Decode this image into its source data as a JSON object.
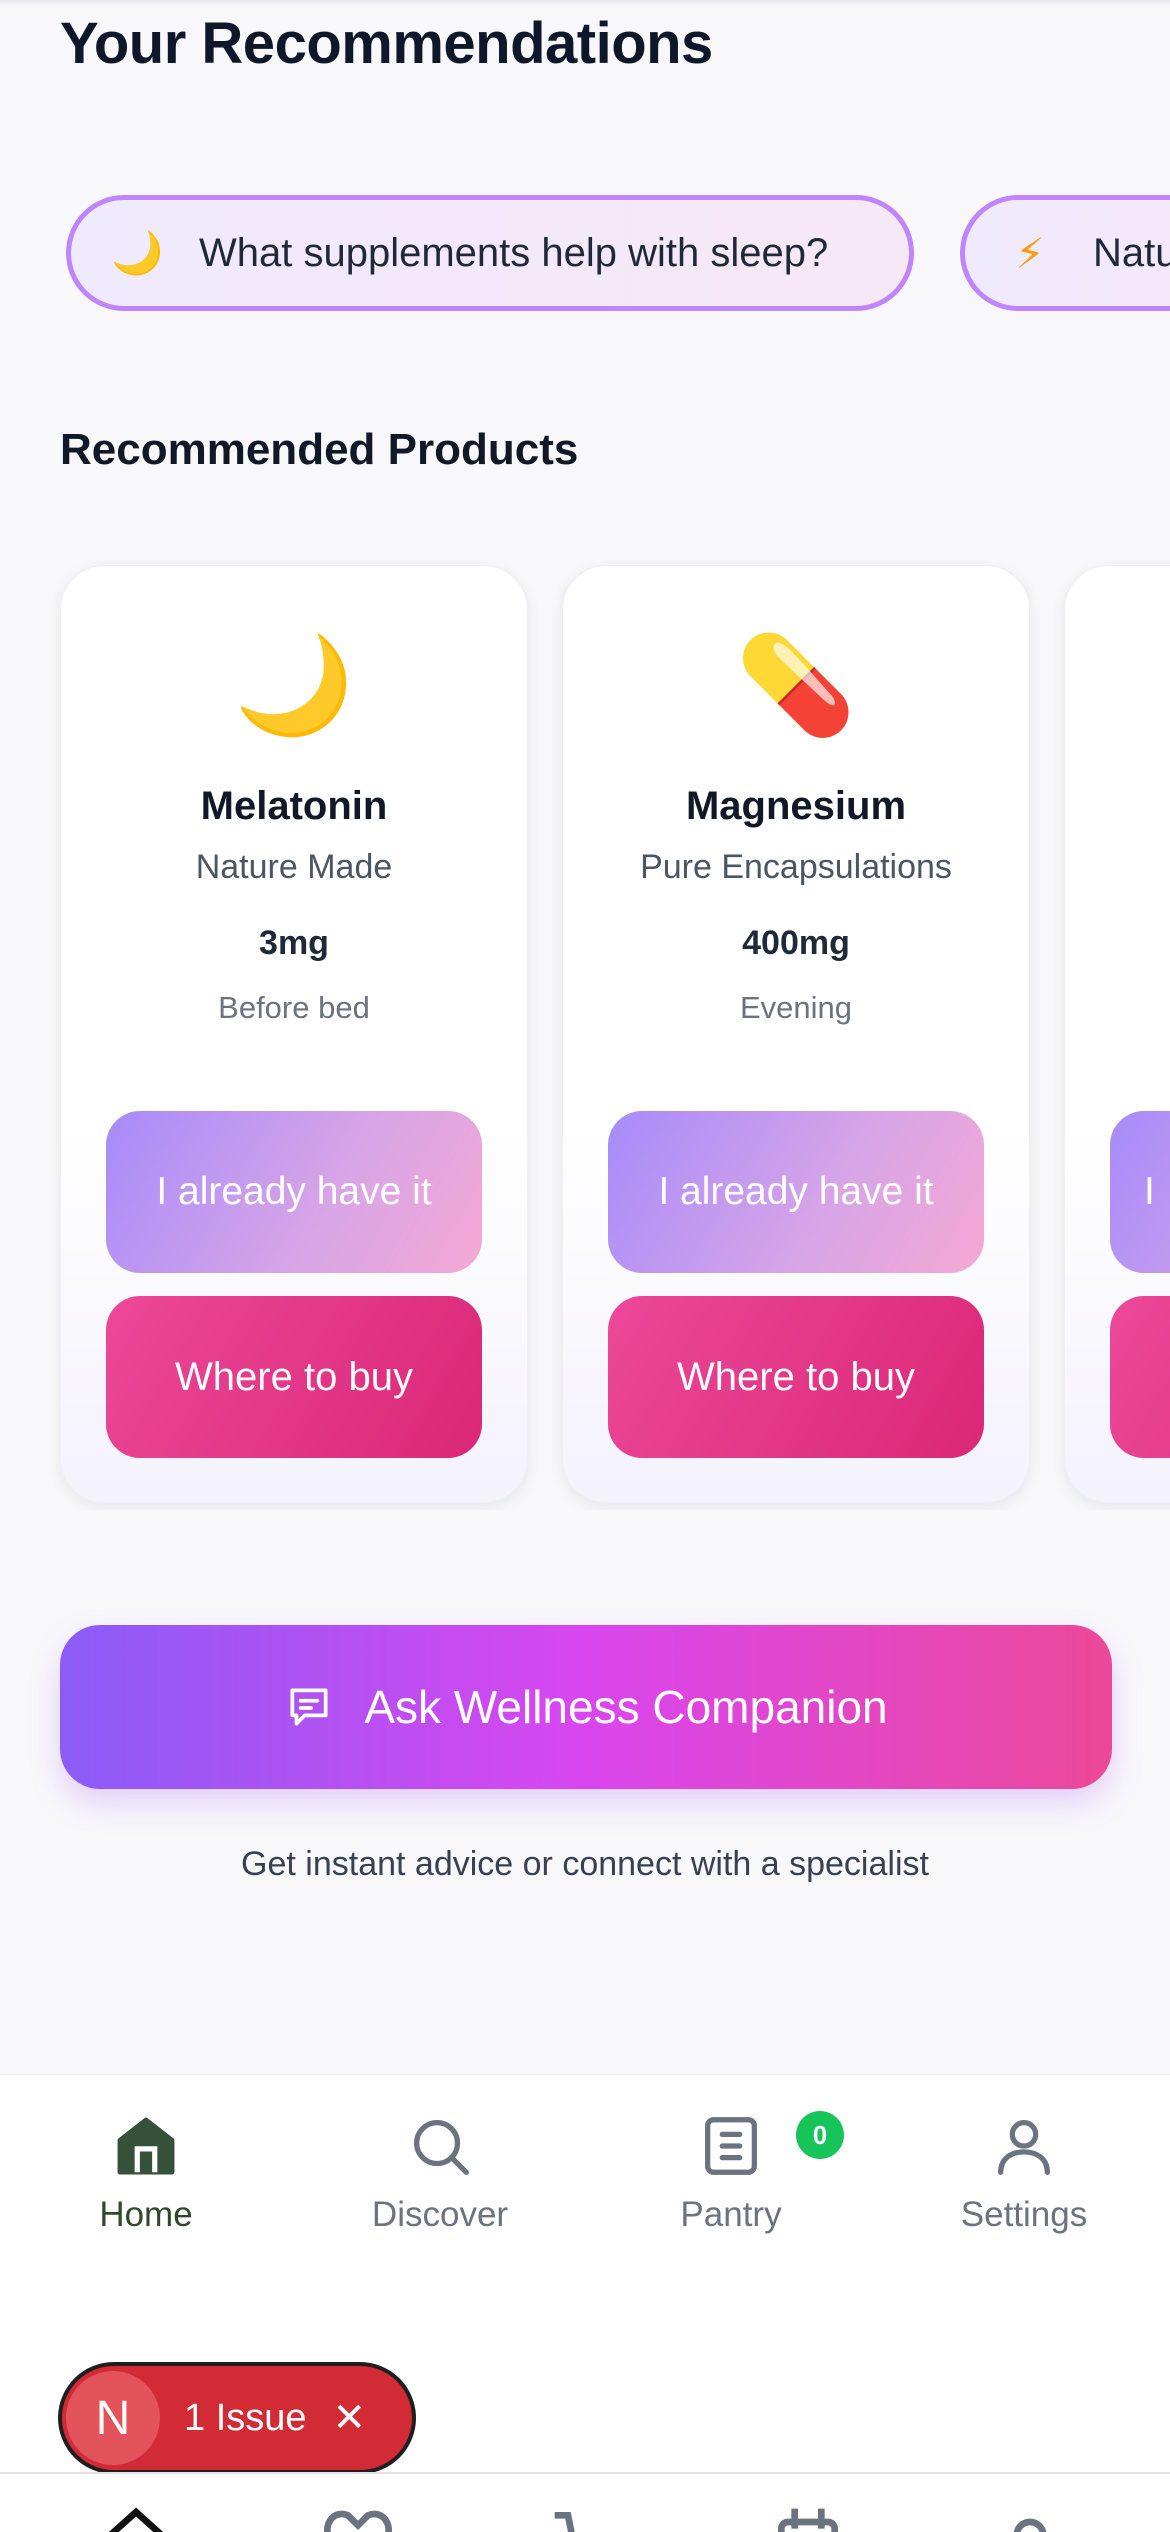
{
  "page": {
    "title": "Your Recommendations"
  },
  "chips": [
    {
      "icon": "🌙",
      "icon_name": "moon-icon",
      "label": "What supplements help with sleep?"
    },
    {
      "icon": "⚡",
      "icon_name": "lightning-icon",
      "label": "Natu"
    }
  ],
  "products_section": {
    "title": "Recommended Products",
    "items": [
      {
        "emoji": "🌙",
        "icon_name": "crescent-moon-icon",
        "name": "Melatonin",
        "brand": "Nature Made",
        "dose": "3mg",
        "timing": "Before bed",
        "have_label": "I already have it",
        "buy_label": "Where to buy"
      },
      {
        "emoji": "💊",
        "icon_name": "pill-icon",
        "name": "Magnesium",
        "brand": "Pure Encapsulations",
        "dose": "400mg",
        "timing": "Evening",
        "have_label": "I already have it",
        "buy_label": "Where to buy"
      },
      {
        "emoji": "",
        "icon_name": "",
        "name": "",
        "brand": "",
        "dose": "",
        "timing": "",
        "have_label": "I",
        "buy_label": ""
      }
    ]
  },
  "companion": {
    "button_label": "Ask Wellness Companion",
    "subtitle": "Get instant advice or connect with a specialist"
  },
  "bottom_nav": {
    "items": [
      {
        "label": "Home",
        "icon": "home-icon",
        "active": true
      },
      {
        "label": "Discover",
        "icon": "search-icon",
        "active": false
      },
      {
        "label": "Pantry",
        "icon": "pantry-icon",
        "active": false,
        "badge": "0"
      },
      {
        "label": "Settings",
        "icon": "user-icon",
        "active": false
      }
    ]
  },
  "issue_toast": {
    "logo": "N",
    "label": "1 Issue",
    "close": "✕"
  },
  "colors": {
    "accent_purple": "#8b5cf6",
    "accent_pink": "#ec4899",
    "home_active": "#2f4a2b",
    "badge_green": "#16c45a",
    "issue_red": "#d22b35"
  }
}
